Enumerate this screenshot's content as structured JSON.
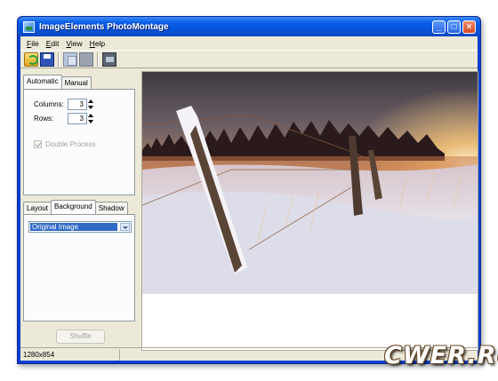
{
  "window": {
    "title": "ImageElements PhotoMontage"
  },
  "menu": [
    {
      "label": "File"
    },
    {
      "label": "Edit"
    },
    {
      "label": "View"
    },
    {
      "label": "Help"
    }
  ],
  "toolbar": {
    "icons": [
      "open-icon",
      "save-icon",
      "copy-icon",
      "paste-icon",
      "image-icon"
    ]
  },
  "top_panel": {
    "tabs": [
      {
        "label": "Automatic",
        "active": true
      },
      {
        "label": "Manual",
        "active": false
      }
    ],
    "columns": {
      "label": "Columns:",
      "value": "3"
    },
    "rows": {
      "label": "Rows:",
      "value": "3"
    },
    "double_process": {
      "label": "Double Process",
      "checked": true,
      "enabled": false
    }
  },
  "bottom_panel": {
    "tabs": [
      {
        "label": "Layout",
        "active": false
      },
      {
        "label": "Background",
        "active": true
      },
      {
        "label": "Shadow",
        "active": false
      }
    ],
    "background_select": {
      "value": "Original Image"
    }
  },
  "shuffle_button": {
    "label": "Shuffle",
    "enabled": false
  },
  "status": {
    "dimensions": "1280x854"
  },
  "watermark": {
    "text": "CWER.RU"
  },
  "colors": {
    "title_bar": "#0552d8",
    "selection": "#316ac5",
    "face": "#ece9d8"
  }
}
